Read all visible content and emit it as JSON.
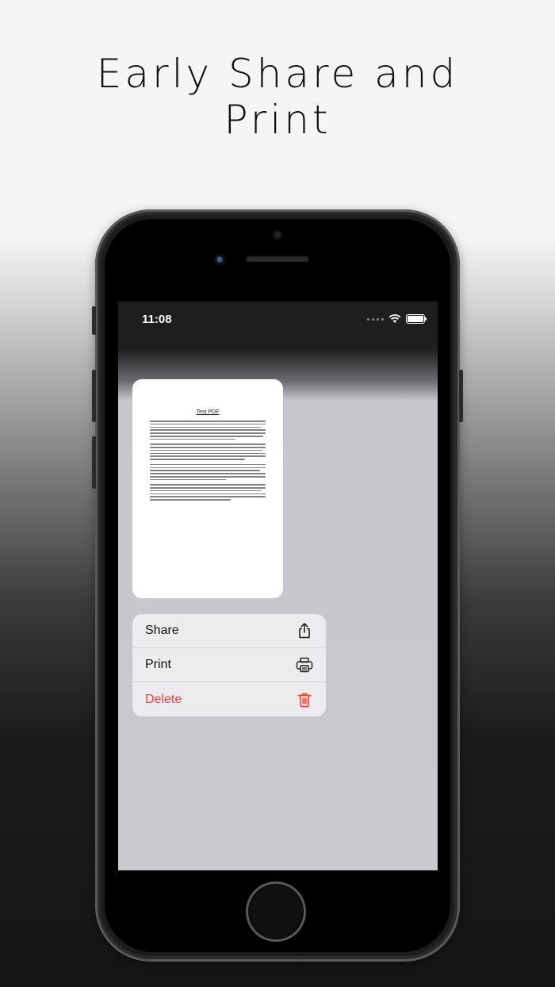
{
  "headline": {
    "line1": "Early Share and",
    "line2": "Print"
  },
  "status_bar": {
    "time": "11:08"
  },
  "preview": {
    "title": "Test PDF"
  },
  "context_menu": {
    "items": [
      {
        "label": "Share",
        "icon": "share-icon"
      },
      {
        "label": "Print",
        "icon": "printer-icon"
      },
      {
        "label": "Delete",
        "icon": "trash-icon",
        "color": "#ff3b30"
      }
    ]
  }
}
